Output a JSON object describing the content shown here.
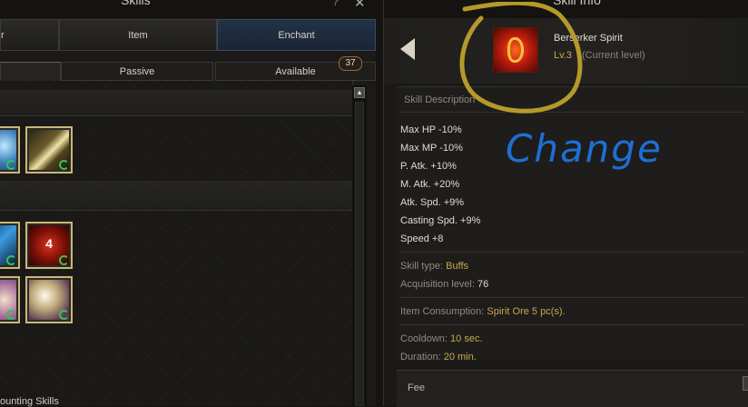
{
  "left_panel": {
    "title": "Skills",
    "help_label": "?",
    "close_label": "✕",
    "tabs_top": [
      {
        "label": "r",
        "active": false
      },
      {
        "label": "Item",
        "active": false
      },
      {
        "label": "Enchant",
        "active": true
      }
    ],
    "tabs_sub": [
      {
        "label": "",
        "selected": true
      },
      {
        "label": "Passive",
        "selected": false
      },
      {
        "label": "Available",
        "selected": false
      }
    ],
    "available_count": "37",
    "skill_4_label": "4",
    "footer_section": "ounting Skills"
  },
  "right_panel": {
    "title": "Skill Info",
    "skill": {
      "name": "Berserker Spirit",
      "level": "Lv.3",
      "level_note": "(Current level)",
      "icon": "berserker-spirit-icon"
    },
    "description_title": "Skill Description",
    "effects": [
      "Max HP -10%",
      "Max MP -10%",
      "P. Atk. +10%",
      "M. Atk. +20%",
      "Atk. Spd. +9%",
      "Casting Spd. +9%",
      "Speed +8"
    ],
    "skill_type": {
      "label": "Skill type",
      "value": "Buffs"
    },
    "acquisition_level": {
      "label": "Acquisition level",
      "value": "76"
    },
    "item_consumption": {
      "label": "Item Consumption",
      "value": "Spirit Ore 5 pc(s)."
    },
    "cooldown": {
      "label": "Cooldown",
      "value": "10 sec."
    },
    "duration": {
      "label": "Duration",
      "value": "20 min."
    },
    "fee_label": "Fee"
  },
  "annotation": {
    "text": "Change",
    "circle_color": "#b59a2a",
    "text_color": "#1e6fd4"
  },
  "colors": {
    "gold": "#c6a84e",
    "active_tab": "#233248",
    "frame": "#c9b67a"
  }
}
